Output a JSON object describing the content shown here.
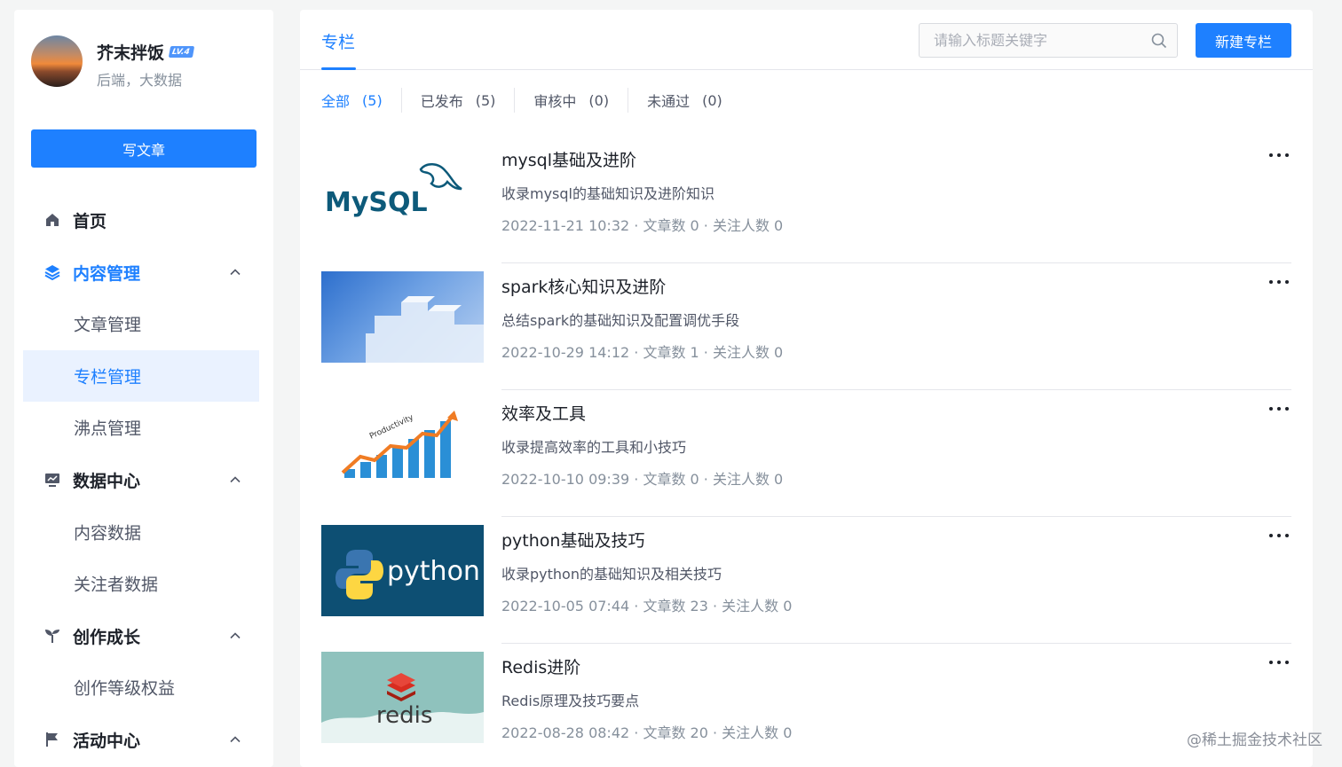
{
  "user": {
    "name": "芥末拌饭",
    "level": "LV.4",
    "bio": "后端，大数据"
  },
  "sidebar": {
    "write_button": "写文章",
    "items": [
      {
        "label": "首页",
        "icon": "home-icon"
      },
      {
        "label": "内容管理",
        "icon": "layers-icon",
        "expanded": true
      },
      {
        "label": "文章管理"
      },
      {
        "label": "专栏管理",
        "selected": true
      },
      {
        "label": "沸点管理"
      },
      {
        "label": "数据中心",
        "icon": "chart-icon",
        "expanded": true
      },
      {
        "label": "内容数据"
      },
      {
        "label": "关注者数据"
      },
      {
        "label": "创作成长",
        "icon": "sprout-icon",
        "expanded": true
      },
      {
        "label": "创作等级权益"
      },
      {
        "label": "活动中心",
        "icon": "flag-icon",
        "expanded": true
      }
    ]
  },
  "header": {
    "tab": "专栏",
    "search_placeholder": "请输入标题关键字",
    "new_button": "新建专栏"
  },
  "filters": [
    {
      "label": "全部",
      "count": "(5)",
      "active": true
    },
    {
      "label": "已发布",
      "count": "(5)"
    },
    {
      "label": "审核中",
      "count": "(0)"
    },
    {
      "label": "未通过",
      "count": "(0)"
    }
  ],
  "columns": [
    {
      "title": "mysql基础及进阶",
      "desc": "收录mysql的基础知识及进阶知识",
      "meta": "2022-11-21 10:32 · 文章数 0 · 关注人数 0",
      "thumb_text": "MySQL"
    },
    {
      "title": "spark核心知识及进阶",
      "desc": "总结spark的基础知识及配置调优手段",
      "meta": "2022-10-29 14:12 · 文章数 1 · 关注人数 0",
      "thumb_text": ""
    },
    {
      "title": "效率及工具",
      "desc": "收录提高效率的工具和小技巧",
      "meta": "2022-10-10 09:39 · 文章数 0 · 关注人数 0",
      "thumb_text": "Productivity"
    },
    {
      "title": "python基础及技巧",
      "desc": "收录python的基础知识及相关技巧",
      "meta": "2022-10-05 07:44 · 文章数 23 · 关注人数 0",
      "thumb_text": "python"
    },
    {
      "title": "Redis进阶",
      "desc": "Redis原理及技巧要点",
      "meta": "2022-08-28 08:42 · 文章数 20 · 关注人数 0",
      "thumb_text": "redis"
    }
  ],
  "watermark": "@稀土掘金技术社区",
  "colors": {
    "accent": "#1e80ff",
    "text": "#1d2129",
    "muted": "#86909c"
  }
}
